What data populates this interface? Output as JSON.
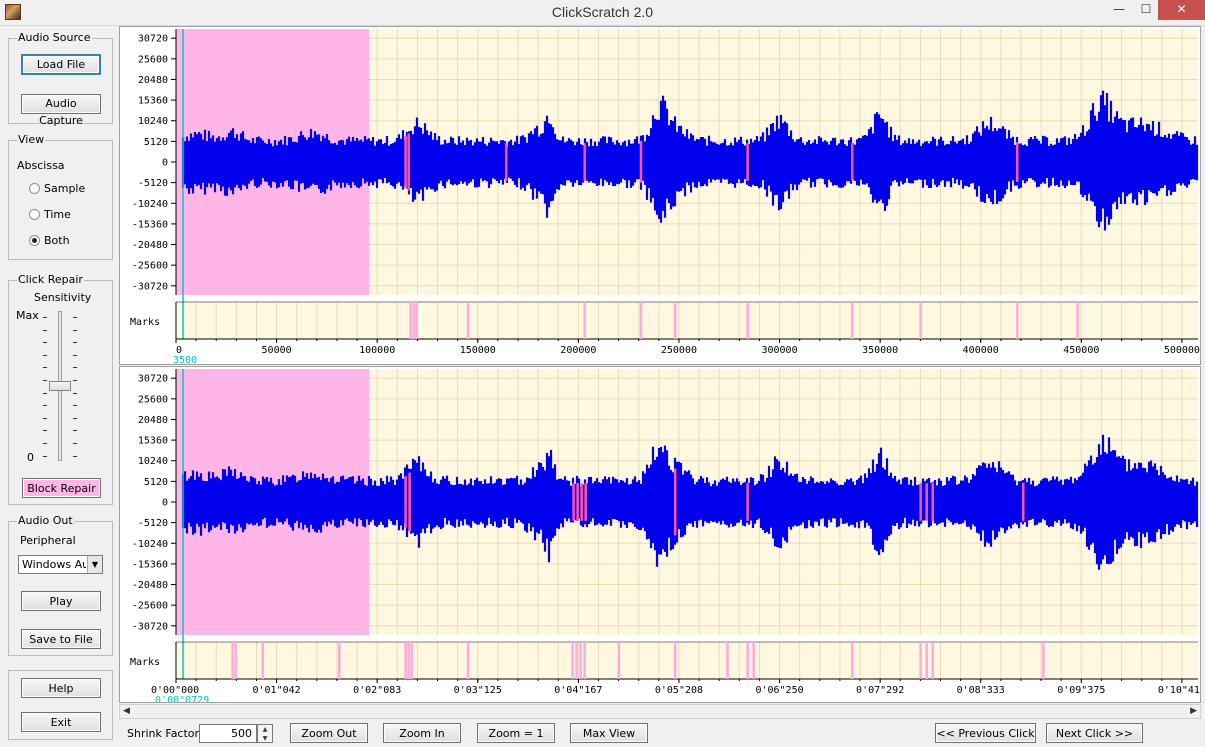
{
  "window": {
    "title": "ClickScratch 2.0",
    "min_glyph": "—",
    "max_glyph": "☐",
    "close_glyph": "✕"
  },
  "audio_source": {
    "legend": "Audio Source",
    "load_file": "Load File",
    "audio_capture": "Audio Capture"
  },
  "view": {
    "legend": "View",
    "abscissa_label": "Abscissa",
    "options": [
      "Sample",
      "Time",
      "Both"
    ],
    "selected": "Both"
  },
  "click_repair": {
    "legend": "Click Repair",
    "sensitivity_label": "Sensitivity",
    "max_label": "Max",
    "min_label": "0",
    "sensitivity_value": 0.48,
    "block_repair": "Block Repair"
  },
  "audio_out": {
    "legend": "Audio Out",
    "peripheral_label": "Peripheral",
    "device": "Windows Auc",
    "play": "Play",
    "save": "Save to File"
  },
  "misc": {
    "help": "Help",
    "exit": "Exit"
  },
  "toolbar": {
    "shrink_label": "Shrink Factor",
    "shrink_value": "500",
    "zoom_out": "Zoom Out",
    "zoom_in": "Zoom In",
    "zoom_1": "Zoom = 1",
    "max_view": "Max View",
    "prev_click": "<< Previous Click",
    "next_click": "Next Click >>"
  },
  "colors": {
    "plot_bg": "#fff8e0",
    "grid": "#e8dcb8",
    "waveform": "#0000ee",
    "selection": "#ffb6e6",
    "marks": "#ffaadd",
    "cursor": "#00c8c8"
  },
  "chart_data": [
    {
      "type": "line",
      "name": "channel-1",
      "y_ticks": [
        "30720",
        "25600",
        "20480",
        "15360",
        "10240",
        "5120",
        "0",
        "-5120",
        "-10240",
        "-15360",
        "-20480",
        "-25600",
        "-30720"
      ],
      "ylim": [
        -33000,
        33000
      ],
      "x_ticks": [
        "0",
        "50000",
        "100000",
        "150000",
        "200000",
        "250000",
        "300000",
        "350000",
        "400000",
        "450000",
        "500000"
      ],
      "xlim": [
        0,
        508000
      ],
      "cursor_label": "3500",
      "marks_label": "Marks",
      "selection": [
        0,
        96000
      ],
      "mark_positions": [
        116500,
        118000,
        119500,
        145000,
        203000,
        231000,
        248000,
        284000,
        336000,
        370000,
        418000,
        448000
      ],
      "repair_positions": [
        114000,
        115500,
        164000,
        203000,
        231000,
        284000,
        336000,
        418000
      ]
    },
    {
      "type": "line",
      "name": "channel-2",
      "y_ticks": [
        "30720",
        "25600",
        "20480",
        "15360",
        "10240",
        "5120",
        "0",
        "-5120",
        "-10240",
        "-15360",
        "-20480",
        "-25600",
        "-30720"
      ],
      "ylim": [
        -33000,
        33000
      ],
      "x_ticks": [
        "0'00\"000",
        "0'01\"042",
        "0'02\"083",
        "0'03\"125",
        "0'04\"167",
        "0'05\"208",
        "0'06\"250",
        "0'07\"292",
        "0'08\"333",
        "0'09\"375",
        "0'10\"417"
      ],
      "xlim": [
        0,
        508000
      ],
      "cursor_label": "0'00\"0729",
      "marks_label": "Marks",
      "selection": [
        0,
        96000
      ],
      "mark_positions": [
        28000,
        29500,
        43000,
        81000,
        114000,
        115500,
        117000,
        145000,
        197000,
        199000,
        201000,
        203000,
        220000,
        248000,
        274000,
        284000,
        287000,
        336000,
        370000,
        373000,
        376000,
        431000
      ],
      "repair_positions": [
        114000,
        116000,
        197500,
        199500,
        201500,
        203500,
        248000,
        284000,
        370000,
        373000,
        376000,
        421000
      ]
    }
  ]
}
